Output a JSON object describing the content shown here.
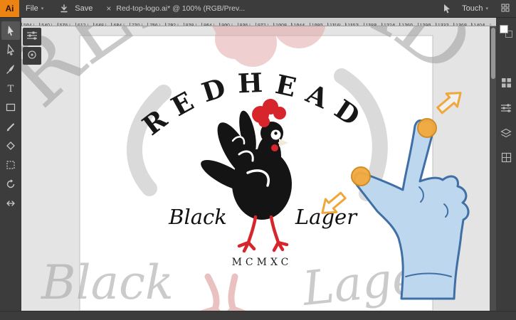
{
  "titlebar": {
    "app_icon_text": "Ai",
    "menus": {
      "file": "File"
    },
    "save_label": "Save",
    "document_tab": "Red-top-logo.ai* @ 100% (RGB/Prev...",
    "workspace_label": "Touch",
    "caret_glyph": "▾",
    "close_glyph": "×"
  },
  "ruler": {
    "ticks": [
      "504",
      "540",
      "576",
      "612",
      "648",
      "684",
      "720",
      "756",
      "792",
      "828",
      "864",
      "900",
      "936",
      "972",
      "1008",
      "1044",
      "1080",
      "1116",
      "1152",
      "1188",
      "1224",
      "1260",
      "1296",
      "1332",
      "1368",
      "1404"
    ]
  },
  "toolbar_tools": [
    "selection",
    "direct-selection",
    "paintbrush",
    "type",
    "artboard",
    "pencil",
    "shaper",
    "free-transform",
    "rotate",
    "reflect"
  ],
  "tools": {
    "type_glyph": "T"
  },
  "logo": {
    "title": "REDHEAD",
    "left_word": "Black",
    "right_word": "Lager",
    "year": "MCMXC"
  },
  "ghost": {
    "arc_text": "REDHEAD",
    "left_word": "Black",
    "right_word": "Lager"
  },
  "colors": {
    "red": "#d6252b",
    "ghost_pink": "#e2a8a8",
    "ghost_red": "#d98f8f",
    "hand_fill": "#bdd7ee",
    "hand_stroke": "#3f6fa5",
    "touch_orange": "#f3a93d",
    "arrow_orange": "#f0a73a"
  }
}
